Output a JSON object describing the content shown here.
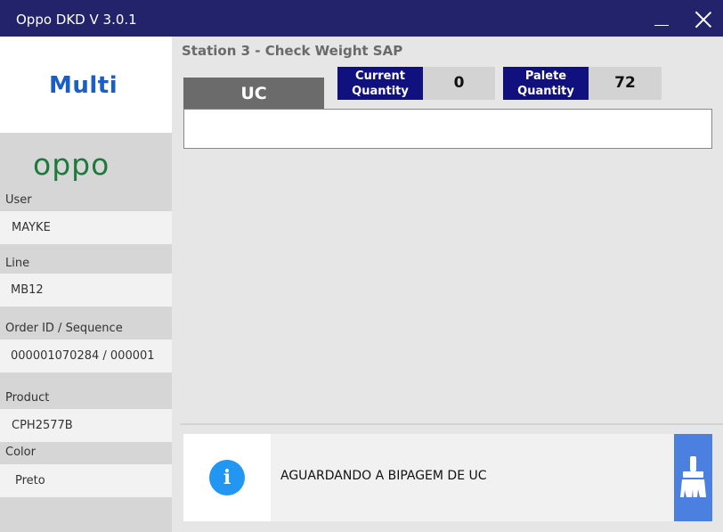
{
  "window": {
    "title": "Oppo DKD V 3.0.1"
  },
  "sidebar": {
    "brand": "Multi",
    "client_brand": "oppo",
    "fields": [
      {
        "label": "User",
        "value": "MAYKE"
      },
      {
        "label": "Line",
        "value": "MB12"
      },
      {
        "label": "Order ID / Sequence",
        "value": "000001070284 / 000001"
      },
      {
        "label": "Product",
        "value": "CPH2577B"
      },
      {
        "label": "Color",
        "value": "Preto"
      }
    ]
  },
  "main": {
    "station_title": "Station 3 - Check Weight SAP",
    "uc_tab": "UC",
    "uc_input": {
      "value": "",
      "placeholder": ""
    },
    "current_quantity": {
      "label_line1": "Current",
      "label_line2": "Quantity",
      "value": "0"
    },
    "palete_quantity": {
      "label_line1": "Palete",
      "label_line2": "Quantity",
      "value": "72"
    }
  },
  "status": {
    "icon": "info-icon",
    "message": "AGUARDANDO A BIPAGEM DE UC",
    "clear_icon": "broom-icon"
  },
  "colors": {
    "titlebar": "#23236b",
    "qty_label_bg": "#10107e",
    "multi_brand": "#1a5ec8",
    "oppo_brand": "#1e7a3c",
    "info": "#2196f3",
    "clear_button": "#4b7fe0"
  }
}
